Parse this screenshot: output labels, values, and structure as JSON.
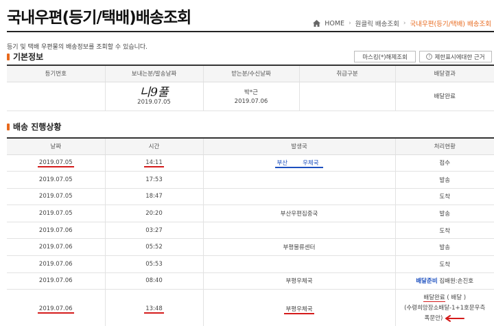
{
  "page": {
    "title": "국내우편(등기/택배)배송조회",
    "description": "등기 및 택배 우편물의 배송정보를 조회할 수 있습니다."
  },
  "breadcrumb": [
    "HOME",
    "원클릭 배송조회",
    "국내우편(등기/택배) 배송조회"
  ],
  "basic_info": {
    "section_title": "기본정보",
    "buttons": {
      "unmask": "마스킹(*)해제조회",
      "notice": "제한표시에대한 근거"
    },
    "headers": [
      "등기번호",
      "보내는분/발송날짜",
      "받는분/수신날짜",
      "취급구분",
      "배달결과"
    ],
    "row": {
      "reg_no": "",
      "sender_signature": "니9풀",
      "sender_date": "2019.07.05",
      "receiver": "박*근",
      "receiver_date": "2019.07.06",
      "handling": "",
      "result": "배달완료"
    }
  },
  "progress": {
    "section_title": "배송 진행상황",
    "headers": [
      "날짜",
      "시간",
      "발생국",
      "처리현황"
    ],
    "rows": [
      {
        "date": "2019.07.05",
        "time": "14:11",
        "office_a": "부산",
        "office_b": "우체국",
        "status": "접수"
      },
      {
        "date": "2019.07.05",
        "time": "17:53",
        "office": "",
        "status": "발송"
      },
      {
        "date": "2019.07.05",
        "time": "18:47",
        "office": "",
        "status": "도착"
      },
      {
        "date": "2019.07.05",
        "time": "20:20",
        "office": "부산우편집중국",
        "status": "발송"
      },
      {
        "date": "2019.07.06",
        "time": "03:27",
        "office": "",
        "status": "도착"
      },
      {
        "date": "2019.07.06",
        "time": "05:52",
        "office": "부평물류센터",
        "status": "발송"
      },
      {
        "date": "2019.07.06",
        "time": "05:53",
        "office": "",
        "status": "도착"
      },
      {
        "date": "2019.07.06",
        "time": "08:40",
        "office": "부평우체국",
        "status_link": "배달준비",
        "status_rest": "집배원:손진호"
      },
      {
        "date": "2019.07.06",
        "time": "13:48",
        "office": "부평우체국",
        "status_l1a": "배달완료",
        "status_l1b": "( 배달 )",
        "status_l2": "(수령희망장소배달-1+1호문우측",
        "status_l3": "폭문안)"
      }
    ]
  },
  "colors": {
    "accent": "#e8691d",
    "link": "#1c4fbf",
    "annotation": "#d41a1a"
  }
}
